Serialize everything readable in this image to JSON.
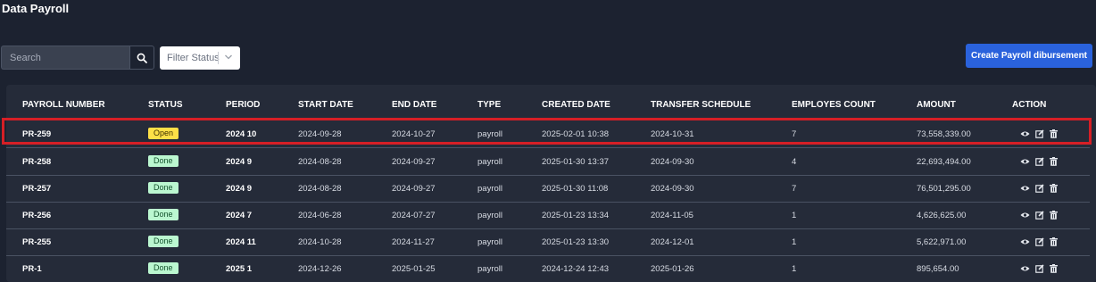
{
  "header": {
    "title": "Data Payroll"
  },
  "toolbar": {
    "search_placeholder": "Search",
    "filter_placeholder": "Filter Status",
    "create_label": "Create Payroll dibursement"
  },
  "table": {
    "columns": [
      "PAYROLL NUMBER",
      "STATUS",
      "PERIOD",
      "START DATE",
      "END DATE",
      "TYPE",
      "CREATED DATE",
      "TRANSFER SCHEDULE",
      "EMPLOYES COUNT",
      "AMOUNT",
      "ACTION"
    ],
    "rows": [
      {
        "number": "PR-259",
        "status": "Open",
        "period": "2024 10",
        "start": "2024-09-28",
        "end": "2024-10-27",
        "type": "payroll",
        "created": "2025-02-01 10:38",
        "transfer": "2024-10-31",
        "count": "7",
        "amount": "73,558,339.00"
      },
      {
        "number": "PR-258",
        "status": "Done",
        "period": "2024 9",
        "start": "2024-08-28",
        "end": "2024-09-27",
        "type": "payroll",
        "created": "2025-01-30 13:37",
        "transfer": "2024-09-30",
        "count": "4",
        "amount": "22,693,494.00"
      },
      {
        "number": "PR-257",
        "status": "Done",
        "period": "2024 9",
        "start": "2024-08-28",
        "end": "2024-09-27",
        "type": "payroll",
        "created": "2025-01-30 11:08",
        "transfer": "2024-09-30",
        "count": "7",
        "amount": "76,501,295.00"
      },
      {
        "number": "PR-256",
        "status": "Done",
        "period": "2024 7",
        "start": "2024-06-28",
        "end": "2024-07-27",
        "type": "payroll",
        "created": "2025-01-23 13:34",
        "transfer": "2024-11-05",
        "count": "1",
        "amount": "4,626,625.00"
      },
      {
        "number": "PR-255",
        "status": "Done",
        "period": "2024 11",
        "start": "2024-10-28",
        "end": "2024-11-27",
        "type": "payroll",
        "created": "2025-01-23 13:30",
        "transfer": "2024-12-01",
        "count": "1",
        "amount": "5,622,971.00"
      },
      {
        "number": "PR-1",
        "status": "Done",
        "period": "2025 1",
        "start": "2024-12-26",
        "end": "2025-01-25",
        "type": "payroll",
        "created": "2024-12-24 12:43",
        "transfer": "2025-01-26",
        "count": "1",
        "amount": "895,654.00"
      }
    ]
  },
  "colors": {
    "open": "#fde047",
    "done": "#bbf7d0",
    "accent": "#2a62dc",
    "highlight": "#d61f26"
  },
  "icons": {
    "view": "eye-icon",
    "edit": "edit-icon",
    "delete": "trash-icon"
  }
}
